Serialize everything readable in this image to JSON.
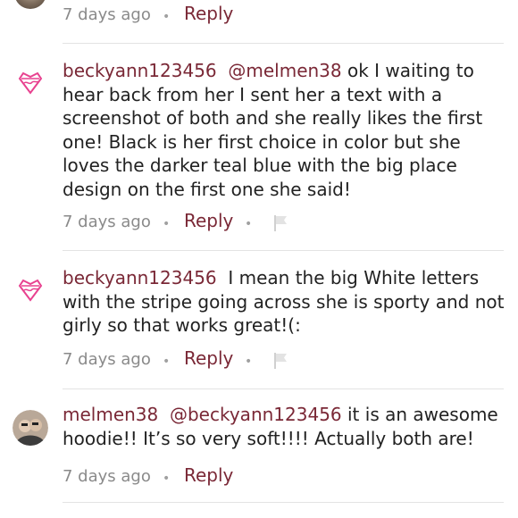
{
  "comments": [
    {
      "time": "7 days ago",
      "reply_label": "Reply",
      "separator": "•"
    },
    {
      "avatar_icon": "princess-crown-avatar-icon",
      "username": "beckyann123456",
      "mention": "@melmen38",
      "text": "ok I waiting to hear back from her I sent her a text with a screenshot of both and she really likes the first one! Black is her first choice in color but she loves the darker teal blue with the big place design on the first one she said!",
      "time": "7 days ago",
      "reply_label": "Reply",
      "separator": "•",
      "flag_icon": "flag-icon"
    },
    {
      "avatar_icon": "princess-crown-avatar-icon",
      "username": "beckyann123456",
      "mention": "",
      "text": "I mean the big White letters with the stripe going across she is sporty and not girly so that works great!(:",
      "time": "7 days ago",
      "reply_label": "Reply",
      "separator": "•",
      "flag_icon": "flag-icon"
    },
    {
      "avatar_icon": "photo-avatar-icon",
      "username": "melmen38",
      "mention": "@beckyann123456",
      "text": "it is an awesome hoodie!! It’s so very soft!!!! Actually both are!",
      "time": "7 days ago",
      "reply_label": "Reply",
      "separator": "•"
    }
  ],
  "colors": {
    "accent": "#7a2836",
    "meta_text": "#8a8a8a",
    "divider": "#e3e3e3",
    "avatar_pink": "#e8418f"
  }
}
